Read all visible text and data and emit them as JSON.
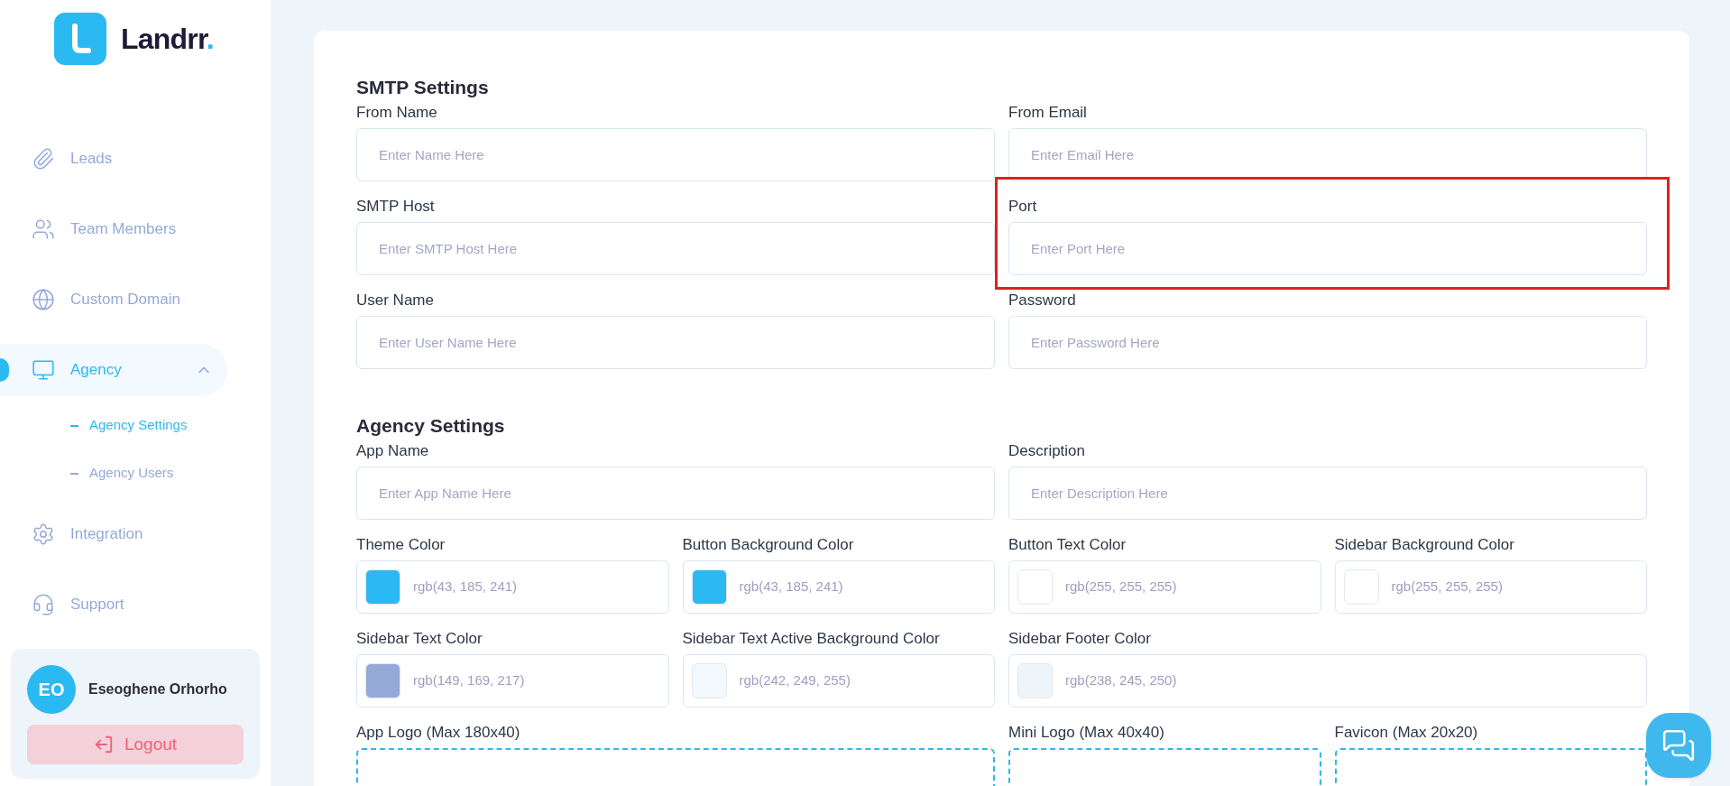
{
  "sidebar": {
    "brand_name": "Landrr",
    "brand_mark": ".",
    "nav": [
      {
        "label": "Leads",
        "selected": false
      },
      {
        "label": "Team Members",
        "selected": false
      },
      {
        "label": "Custom Domain",
        "selected": false
      },
      {
        "label": "Agency",
        "selected": true,
        "expanded": true,
        "children": [
          {
            "label": "Agency Settings",
            "selected": true
          },
          {
            "label": "Agency Users",
            "selected": false
          }
        ]
      },
      {
        "label": "Integration",
        "selected": false
      },
      {
        "label": "Support",
        "selected": false
      }
    ],
    "user": {
      "initials": "EO",
      "name": "Eseoghene Orhorho"
    },
    "logout": "Logout"
  },
  "form": {
    "sections": [
      {
        "title": "SMTP Settings",
        "rows": [
          [
            {
              "kind": "text",
              "label": "From Name",
              "placeholder": "Enter Name Here",
              "highlighted": false
            },
            "",
            {
              "kind": "text",
              "label": "From Email",
              "placeholder": "Enter Email Here",
              "highlighted": false
            }
          ],
          [
            {
              "kind": "text",
              "label": "SMTP Host",
              "placeholder": "Enter SMTP Host Here",
              "highlighted": false
            },
            "",
            {
              "kind": "text",
              "label": "Port",
              "placeholder": "Enter Port Here",
              "highlighted": true
            }
          ],
          [
            {
              "kind": "text",
              "label": "User Name",
              "placeholder": "Enter User Name Here",
              "highlighted": false
            },
            "",
            {
              "kind": "text",
              "label": "Password",
              "placeholder": "Enter Password Here",
              "highlighted": false
            }
          ]
        ]
      },
      {
        "title": "Agency Settings",
        "rows": [
          [
            {
              "kind": "text",
              "label": "App Name",
              "placeholder": "Enter App Name Here",
              "highlighted": false
            },
            "",
            {
              "kind": "text",
              "label": "Description",
              "placeholder": "Enter Description Here",
              "highlighted": false
            }
          ],
          [
            {
              "kind": "color",
              "label": "Theme Color",
              "value": "rgb(43, 185, 241)",
              "color": "#2bb9f1"
            },
            {
              "kind": "color",
              "label": "Button Background Color",
              "value": "rgb(43, 185, 241)",
              "color": "#2bb9f1"
            },
            {
              "kind": "color",
              "label": "Button Text Color",
              "value": "rgb(255, 255, 255)",
              "color": "#ffffff"
            },
            {
              "kind": "color",
              "label": "Sidebar Background Color",
              "value": "rgb(255, 255, 255)",
              "color": "#ffffff"
            }
          ],
          [
            {
              "kind": "color",
              "label": "Sidebar Text Color",
              "value": "rgb(149, 169, 217)",
              "color": "#95a9d9"
            },
            {
              "kind": "color",
              "label": "Sidebar Text Active Background Color",
              "value": "rgb(242, 249, 255)",
              "color": "#f2f9ff"
            },
            {
              "kind": "color",
              "label": "Sidebar Footer Color",
              "value": "rgb(238, 245, 250)",
              "color": "#eef5fa"
            }
          ],
          [
            {
              "kind": "upload",
              "label": "App Logo (Max 180x40)"
            },
            "",
            {
              "kind": "upload",
              "label": "Mini Logo (Max 40x40)"
            },
            {
              "kind": "upload",
              "label": "Favicon (Max 20x20)"
            }
          ]
        ]
      }
    ]
  }
}
